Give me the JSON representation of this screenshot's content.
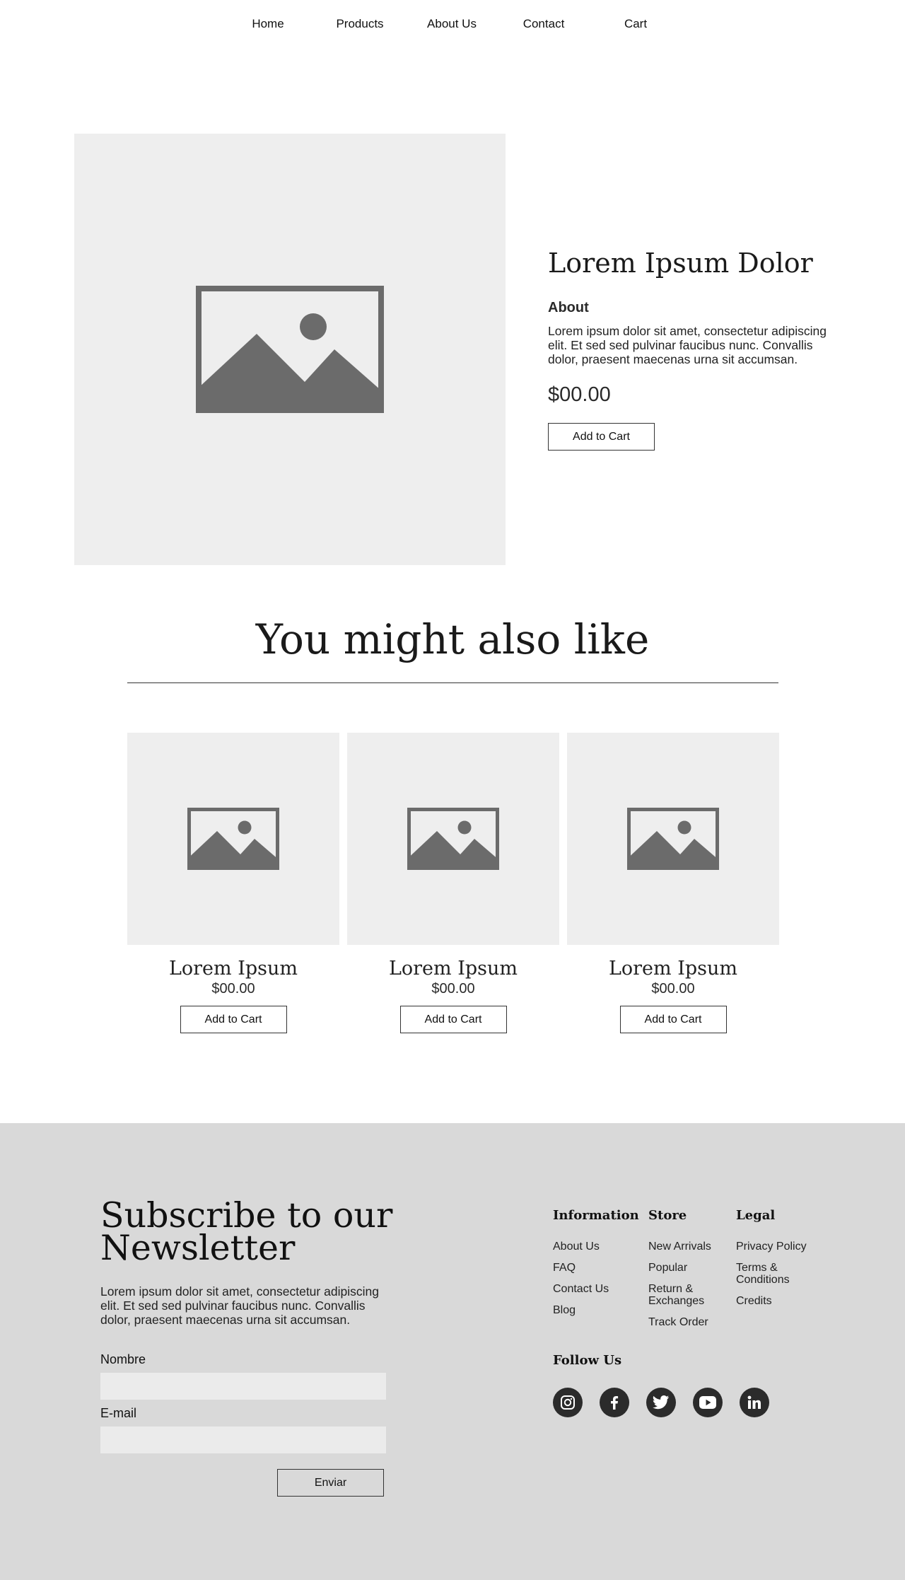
{
  "nav": {
    "items": [
      "Home",
      "Products",
      "About Us",
      "Contact",
      "Cart"
    ]
  },
  "product": {
    "image_icon": "image-placeholder-icon",
    "title": "Lorem Ipsum Dolor",
    "about_heading": "About",
    "description": "Lorem ipsum dolor sit amet, consectetur adipiscing elit. Et sed sed pulvinar faucibus nunc. Convallis dolor, praesent maecenas urna sit accumsan.",
    "price": "$00.00",
    "add_to_cart": "Add to Cart"
  },
  "recommendations": {
    "title": "You might also like",
    "items": [
      {
        "name": "Lorem Ipsum",
        "price": "$00.00",
        "button": "Add to Cart"
      },
      {
        "name": "Lorem Ipsum",
        "price": "$00.00",
        "button": "Add to Cart"
      },
      {
        "name": "Lorem Ipsum",
        "price": "$00.00",
        "button": "Add to Cart"
      }
    ]
  },
  "footer": {
    "newsletter": {
      "title": "Subscribe to our Newsletter",
      "description": "Lorem ipsum dolor sit amet, consectetur adipiscing elit. Et sed sed pulvinar faucibus nunc. Convallis dolor, praesent maecenas urna sit accumsan.",
      "name_label": "Nombre",
      "email_label": "E-mail",
      "submit": "Enviar"
    },
    "columns": [
      {
        "heading": "Information",
        "links": [
          "About Us",
          "FAQ",
          "Contact Us",
          "Blog"
        ]
      },
      {
        "heading": "Store",
        "links": [
          "New Arrivals",
          "Popular",
          "Return & Exchanges",
          "Track Order"
        ]
      },
      {
        "heading": "Legal",
        "links": [
          "Privacy Policy",
          "Terms & Conditions",
          "Credits"
        ]
      }
    ],
    "follow": {
      "heading": "Follow Us",
      "icons": [
        "instagram-icon",
        "facebook-icon",
        "twitter-icon",
        "youtube-icon",
        "linkedin-icon"
      ]
    }
  },
  "colors": {
    "placeholder_bg": "#eeeeee",
    "placeholder_icon": "#6b6b6b",
    "footer_bg": "#d9d9d9",
    "input_bg": "#ebebeb",
    "social_bg": "#2b2b2b"
  }
}
